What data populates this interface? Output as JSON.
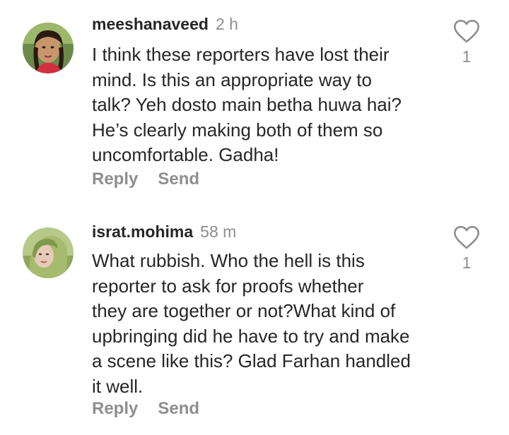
{
  "comments": [
    {
      "username": "meeshanaveed",
      "time": "2 h",
      "text_lines": [
        "I think these reporters have lost their",
        "mind. Is this an appropriate way to",
        "talk? Yeh dosto main betha huwa hai?",
        "He’s clearly making both of them so",
        "uncomfortable. Gadha!"
      ],
      "reply_label": "Reply",
      "send_label": "Send",
      "likes": "1",
      "like_icon": "heart-icon"
    },
    {
      "username": "israt.mohima",
      "time": "58 m",
      "text_lines": [
        "What rubbish. Who the hell is this",
        "reporter to ask for proofs whether",
        "they are together or not?What kind of",
        "upbringing did he have to try and make",
        "a scene like this? Glad Farhan handled",
        "it well."
      ],
      "reply_label": "Reply",
      "send_label": "Send",
      "likes": "1",
      "like_icon": "heart-icon"
    }
  ],
  "colors": {
    "primary_text": "#262626",
    "secondary_text": "#8e8e8e",
    "heart_outline": "#8e8e8e"
  }
}
